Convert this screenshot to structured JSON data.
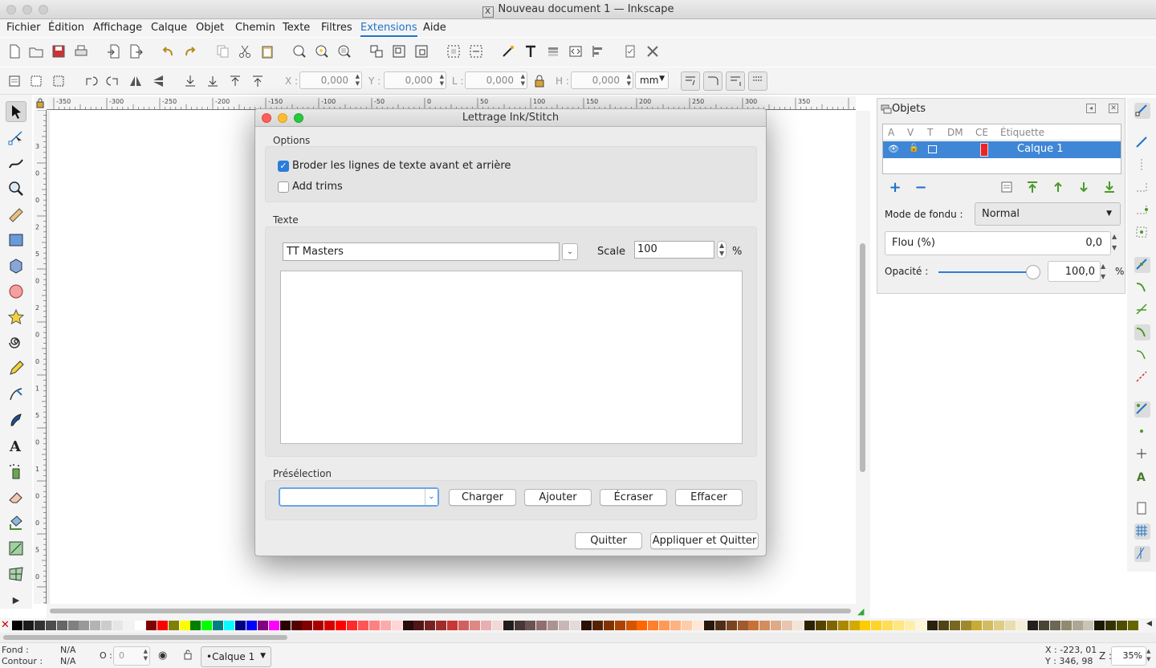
{
  "window": {
    "title": "Nouveau document 1 — Inkscape",
    "app_icon": "x-icon"
  },
  "menu": [
    "Fichier",
    "Édition",
    "Affichage",
    "Calque",
    "Objet",
    "Chemin",
    "Texte",
    "Filtres",
    "Extensions",
    "Aide"
  ],
  "active_menu": "Extensions",
  "ctrl": {
    "x_label": "X :",
    "x_value": "0,000",
    "y_label": "Y :",
    "y_value": "0,000",
    "w_label": "L :",
    "w_value": "0,000",
    "h_label": "H :",
    "h_value": "0,000",
    "unit": "mm"
  },
  "ruler_h_ticks": [
    "-350",
    "-300",
    "-250",
    "-200",
    "-150",
    "-100",
    "-50",
    "0",
    "50",
    "100",
    "150",
    "200",
    "250",
    "300",
    "350"
  ],
  "ruler_v_ticks": [
    "3",
    "0",
    "0",
    "2",
    "5",
    "0",
    "2",
    "0",
    "0",
    "1",
    "5",
    "0",
    "1",
    "0",
    "0",
    "5",
    "0"
  ],
  "dialog": {
    "title": "Lettrage Ink/Stitch",
    "options_title": "Options",
    "opt_back_forth": "Broder les lignes de texte avant et arrière",
    "opt_back_forth_checked": true,
    "opt_trims": "Add trims",
    "opt_trims_checked": false,
    "text_title": "Texte",
    "font_value": "TT Masters",
    "scale_label": "Scale",
    "scale_value": "100",
    "percent": "%",
    "text_area_value": "",
    "preset_title": "Présélection",
    "preset_value": "",
    "btn_load": "Charger",
    "btn_add": "Ajouter",
    "btn_overwrite": "Écraser",
    "btn_delete": "Effacer",
    "btn_quit": "Quitter",
    "btn_apply_quit": "Appliquer et Quitter"
  },
  "objects_panel": {
    "title": "Objets",
    "columns": [
      "A",
      "V",
      "T",
      "DM",
      "CE",
      "Étiquette"
    ],
    "layer_label": "Calque 1",
    "blend_label": "Mode de fondu :",
    "blend_value": "Normal",
    "blur_label": "Flou (%)",
    "blur_value": "0,0",
    "opacity_label": "Opacité :",
    "opacity_value": "100,0",
    "opacity_unit": "%",
    "opacity_level": 1.0
  },
  "status": {
    "fill_label": "Fond :",
    "fill_value": "N/A",
    "stroke_label": "Contour :",
    "stroke_value": "N/A",
    "o_label": "O :",
    "o_value": "0",
    "layer": "•Calque 1",
    "x_coord": "X : -223, 01",
    "y_coord": "Y :  346, 98",
    "z_label": "Z :",
    "zoom": "35%"
  },
  "palette_colors": [
    "#000000",
    "#1a1a1a",
    "#333333",
    "#4d4d4d",
    "#666666",
    "#808080",
    "#999999",
    "#b3b3b3",
    "#cccccc",
    "#e6e6e6",
    "#f2f2f2",
    "#ffffff",
    "#800000",
    "#ff0000",
    "#808000",
    "#ffff00",
    "#008000",
    "#00ff00",
    "#008080",
    "#00ffff",
    "#000080",
    "#0000ff",
    "#800080",
    "#ff00ff",
    "#2b0000",
    "#550000",
    "#800000",
    "#aa0000",
    "#d40000",
    "#ff0000",
    "#ff2a2a",
    "#ff5555",
    "#ff8080",
    "#ffaaaa",
    "#ffd5d5",
    "#280b0b",
    "#501616",
    "#782121",
    "#a02c2c",
    "#c83737",
    "#d35f5f",
    "#de8787",
    "#e9afaf",
    "#f4d7d7",
    "#241c1c",
    "#483737",
    "#6c5353",
    "#916f6f",
    "#ac9393",
    "#c8b7b7",
    "#e3dbdb",
    "#2b1100",
    "#552200",
    "#803300",
    "#aa4400",
    "#d45500",
    "#ff6600",
    "#ff7f2a",
    "#ff9955",
    "#ffb380",
    "#ffccaa",
    "#ffe6d5",
    "#28170b",
    "#502d16",
    "#784421",
    "#a05a2c",
    "#c87137",
    "#d38d5f",
    "#deaa87",
    "#e9c6af",
    "#f4e3d7",
    "#2b2200",
    "#554400",
    "#806600",
    "#aa8800",
    "#d4aa00",
    "#ffcc00",
    "#ffd42a",
    "#ffdd55",
    "#ffe680",
    "#ffeeaa",
    "#fff6d5",
    "#28220b",
    "#504416",
    "#786721",
    "#a0892c",
    "#c8ab37",
    "#d3bc5f",
    "#decd87",
    "#e9ddaf",
    "#f4eed7",
    "#241f1c",
    "#484537",
    "#6c6753",
    "#918a6f",
    "#aca793",
    "#c8c4b7",
    "#1a1a00",
    "#333300",
    "#4d4d00",
    "#666600"
  ]
}
